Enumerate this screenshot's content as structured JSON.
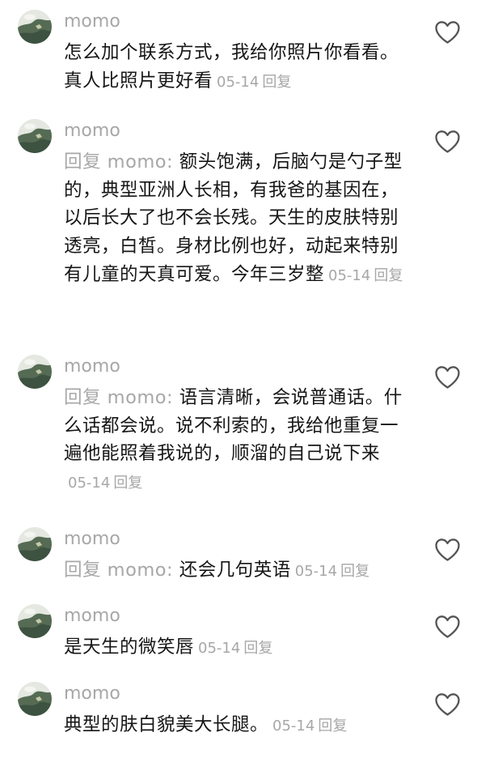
{
  "colors": {
    "text": "#161616",
    "muted": "#a7a7a7",
    "background": "#ffffff",
    "like_icon_stroke": "#545454"
  },
  "icons": {
    "like": "heart-outline-icon",
    "avatar": "landscape-avatar-image"
  },
  "comments": [
    {
      "username": "momo",
      "reply_prefix": "",
      "reply_to": "",
      "text": "怎么加个联系方式，我给你照片你看看。真人比照片更好看",
      "date": "05-14",
      "reply_label": "回复"
    },
    {
      "username": "momo",
      "reply_prefix": "回复 ",
      "reply_to": "momo: ",
      "text": "额头饱满，后脑勺是勺子型的，典型亚洲人长相，有我爸的基因在，以后长大了也不会长残。天生的皮肤特别透亮，白皙。身材比例也好，动起来特别有儿童的天真可爱。今年三岁整",
      "date": "05-14",
      "reply_label": "回复"
    },
    {
      "username": "momo",
      "reply_prefix": "回复 ",
      "reply_to": "momo: ",
      "text": "语言清晰，会说普通话。什么话都会说。说不利索的，我给他重复一遍他能照着我说的，顺溜的自己说下来",
      "date": "05-14",
      "reply_label": "回复"
    },
    {
      "username": "momo",
      "reply_prefix": "回复 ",
      "reply_to": "momo: ",
      "text": "还会几句英语",
      "date": "05-14",
      "reply_label": "回复"
    },
    {
      "username": "momo",
      "reply_prefix": "",
      "reply_to": "",
      "text": "是天生的微笑唇",
      "date": "05-14",
      "reply_label": "回复"
    },
    {
      "username": "momo",
      "reply_prefix": "",
      "reply_to": "",
      "text": "典型的肤白貌美大长腿。",
      "date": "05-14",
      "reply_label": "回复"
    }
  ]
}
